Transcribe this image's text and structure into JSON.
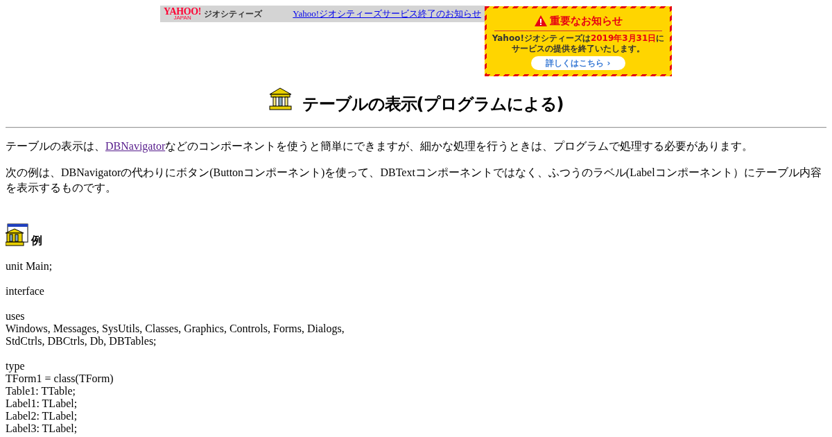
{
  "top_bar": {
    "logo": "YAHOO!",
    "logo_sub": "JAPAN",
    "service": "ジオシティーズ",
    "link": "Yahoo!ジオシティーズサービス終了のお知らせ"
  },
  "notice": {
    "title": "重要なお知らせ",
    "line1": [
      {
        "text": "Yahoo!ジオシティーズは",
        "highlight": false
      },
      {
        "text": "2019年3月31日",
        "highlight": true
      },
      {
        "text": "に",
        "highlight": false
      }
    ],
    "line2": "サービスの提供を終了いたします。",
    "button": "詳しくはこちら ›"
  },
  "heading": "テーブルの表示(プログラムによる)",
  "intro": [
    {
      "before": "テーブルの表示は、",
      "link": "DBNavigator",
      "after": "などのコンポーネントを使うと簡単にできますが、細かな処理を行うときは、プログラムで処理する必要があります。"
    }
  ],
  "description": "次の例は、DBNavigatorの代わりにボタン(Buttonコンポーネント)を使って、DBTextコンポーネントではなく、ふつうのラベル(Labelコンポーネント）にテーブル内容を表示するものです。",
  "example_heading": "例",
  "code": [
    [
      "unit Main;"
    ],
    [
      "interface"
    ],
    [
      "uses",
      "Windows, Messages, SysUtils, Classes, Graphics, Controls, Forms, Dialogs,",
      "StdCtrls, DBCtrls, Db, DBTables;"
    ],
    [
      "type",
      "TForm1 = class(TForm)",
      "Table1: TTable;",
      "Label1: TLabel;",
      "Label2: TLabel;",
      "Label3: TLabel;"
    ]
  ]
}
